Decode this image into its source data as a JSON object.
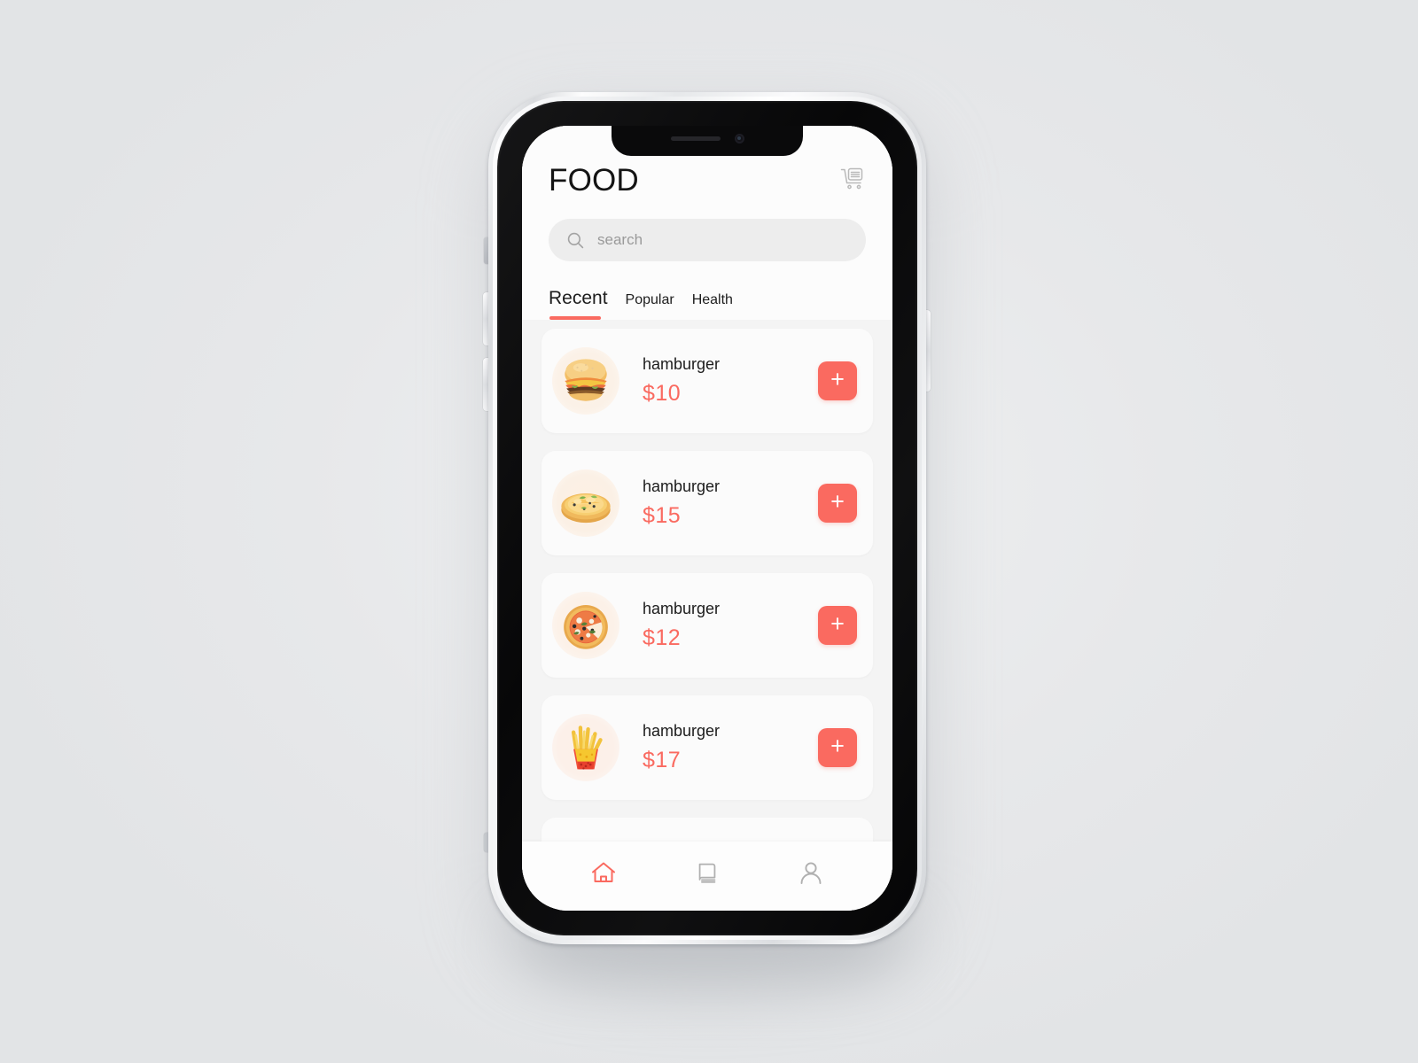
{
  "app": {
    "title": "FOOD",
    "cart_icon": "shopping-cart-icon"
  },
  "search": {
    "placeholder": "search",
    "value": "",
    "icon": "search-icon"
  },
  "tabs": [
    {
      "label": "Recent",
      "active": true
    },
    {
      "label": "Popular",
      "active": false
    },
    {
      "label": "Health",
      "active": false
    }
  ],
  "food_list": [
    {
      "name": "hamburger",
      "price": "$10",
      "thumb": "hamburger-image",
      "add_label": "+"
    },
    {
      "name": "hamburger",
      "price": "$15",
      "thumb": "pasta-pizza-image",
      "add_label": "+"
    },
    {
      "name": "hamburger",
      "price": "$12",
      "thumb": "pizza-image",
      "add_label": "+"
    },
    {
      "name": "hamburger",
      "price": "$17",
      "thumb": "fries-image",
      "add_label": "+"
    }
  ],
  "bottom_nav": [
    {
      "name": "home",
      "icon": "home-icon",
      "active": true
    },
    {
      "name": "menu",
      "icon": "book-icon",
      "active": false
    },
    {
      "name": "profile",
      "icon": "person-icon",
      "active": false
    }
  ],
  "colors": {
    "accent": "#FA6A60",
    "screen_bg": "#FCFCFC",
    "list_bg": "#F4F4F4",
    "card_bg": "#FBFBFB",
    "search_bg": "#EDEDED",
    "text": "#1C1C1C",
    "muted": "#9A9A9A",
    "page_bg": "#E9EAEC"
  }
}
